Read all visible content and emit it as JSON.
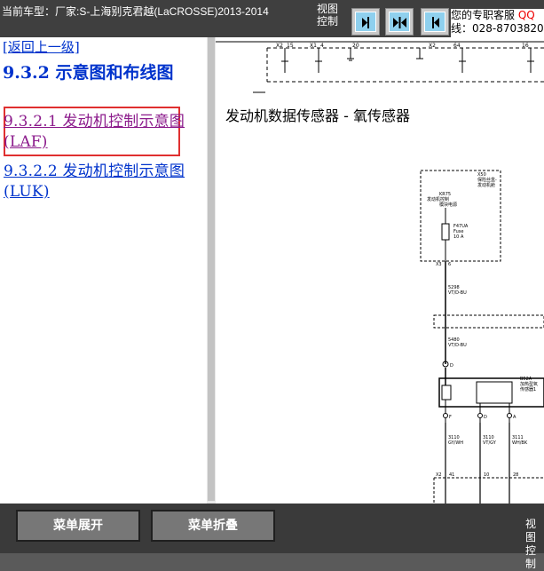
{
  "topbar": {
    "vehicle": "当前车型：厂家:S-上海别克君越(LaCROSSE)2013-2014",
    "view_control": [
      "视图",
      "控制"
    ],
    "service_line1": "您的专职客服",
    "service_qq": "QQ",
    "service_line2": "线：028-8703820"
  },
  "leftnav": {
    "back_link": "[返回上一级]",
    "section_title": "9.3.2 示意图和布线图",
    "items": [
      {
        "label": "9.3.2.1 发动机控制示意图 (LAF)",
        "selected": true
      },
      {
        "label": "9.3.2.2 发动机控制示意图 (LUK)",
        "selected": false
      }
    ]
  },
  "diagram": {
    "title": "发动机数据传感器 - 氧传感器",
    "fuse_box_label": [
      "X50",
      "保险丝盒-",
      "发动机舱"
    ],
    "fuse_label_small": [
      "KR75",
      "发动机控制",
      "模块电源"
    ],
    "fuse": [
      "F47UA",
      "Fuse",
      "10 A"
    ],
    "connector_x3": "X3",
    "pin_6": "6",
    "wire_5298": [
      "5298",
      "VT/D-BU"
    ],
    "wire_5480": [
      "5480",
      "VT/D-BU"
    ],
    "sensor_label": [
      "B52A",
      "加热型氧",
      "传感器1"
    ],
    "pins": [
      "F",
      "D",
      "A"
    ],
    "wires": [
      {
        "num": "3110",
        "color": "GY/WH"
      },
      {
        "num": "3110",
        "color": "VT/GY"
      },
      {
        "num": "3111",
        "color": "WH/BK"
      }
    ],
    "bottom_connector": "X2",
    "bottom_pins": [
      "41",
      "10",
      "28"
    ],
    "top_connectors": [
      "X2",
      "15",
      "X1",
      "4",
      "20",
      "X2",
      "64",
      "16"
    ]
  },
  "bottombar": {
    "expand_label": "菜单展开",
    "collapse_label": "菜单折叠",
    "view_control": [
      "视图",
      "控制"
    ]
  }
}
